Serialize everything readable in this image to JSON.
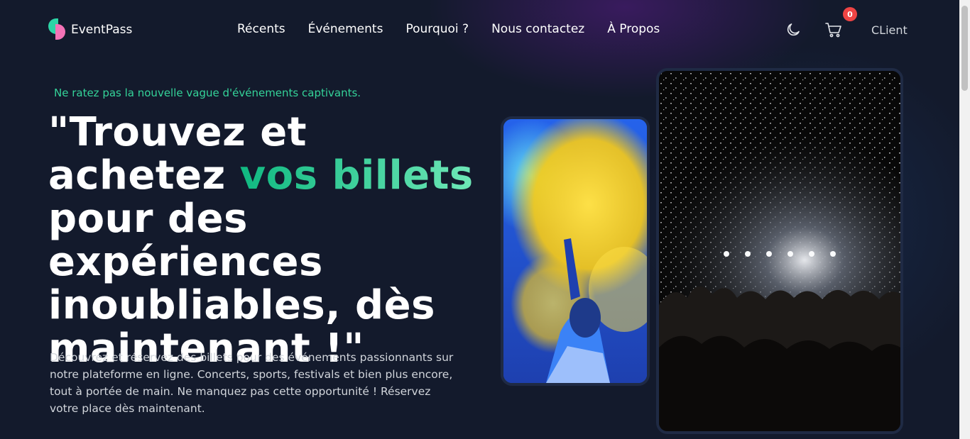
{
  "brand": {
    "name": "EventPass"
  },
  "nav": {
    "items": [
      {
        "label": "Récents"
      },
      {
        "label": "Événements"
      },
      {
        "label": "Pourquoi ?"
      },
      {
        "label": "Nous contactez"
      },
      {
        "label": "À Propos"
      }
    ]
  },
  "header": {
    "cart_count": "0",
    "user_label": "CLient"
  },
  "hero": {
    "tagline": "Ne ratez pas la nouvelle vague d'événements captivants.",
    "title_part1": "\"Trouvez et achetez ",
    "title_highlight": "vos billets",
    "title_part2": " pour des expériences inoubliables, dès maintenant !\"",
    "description": "Découvrez et réservez des billets pour des événements passionnants sur notre plateforme en ligne. Concerts, sports, festivals et bien plus encore, tout à portée de main. Ne manquez pas cette opportunité ! Réservez votre place dès maintenant."
  },
  "icons": {
    "theme": "moon-icon",
    "cart": "cart-icon"
  },
  "colors": {
    "background": "#131a2c",
    "accent": "#34d399",
    "logo_green": "#2dd4a6",
    "logo_pink": "#f472b6",
    "badge": "#ef4444"
  }
}
